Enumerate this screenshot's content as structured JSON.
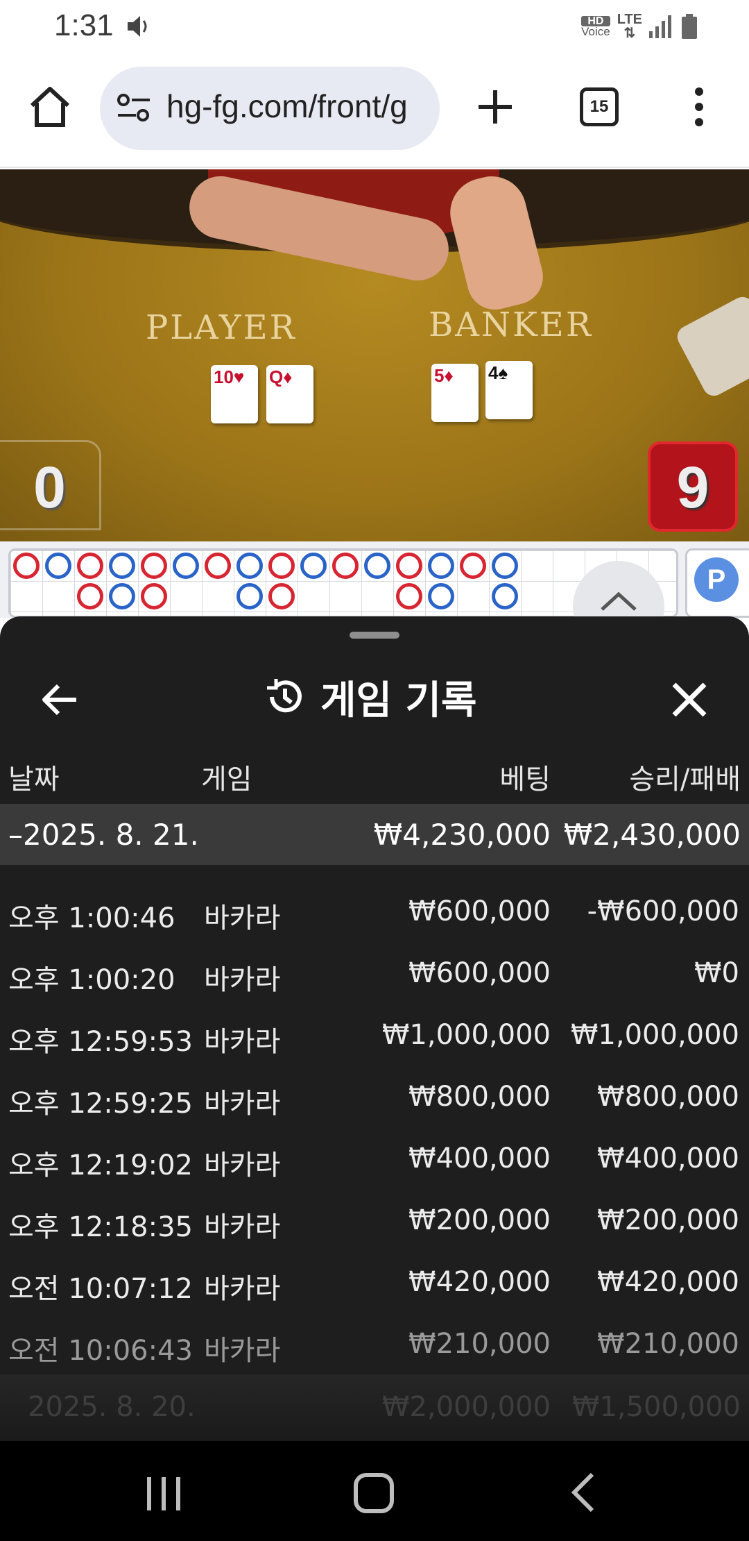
{
  "status_bar": {
    "time": "1:31",
    "hd_label": "HD",
    "voice_label": "Voice",
    "network": "LTE"
  },
  "browser": {
    "url": "hg-fg.com/front/g",
    "tab_count": "15"
  },
  "game_table": {
    "player_label": "PLAYER",
    "banker_label": "BANKER",
    "player_cards": [
      "10",
      "Q"
    ],
    "banker_cards": [
      "5",
      "4"
    ],
    "player_score": "0",
    "banker_score": "9",
    "side_badge": "P"
  },
  "history_sheet": {
    "title": "게임 기록",
    "columns": {
      "date": "날짜",
      "game": "게임",
      "bet": "베팅",
      "win_loss": "승리/패배"
    },
    "group": {
      "date": "–2025. 8. 21.",
      "bet_total": "₩4,230,000",
      "win_total": "₩2,430,000"
    },
    "rows": [
      {
        "time": "오후 1:00:46",
        "game": "바카라",
        "bet": "₩600,000",
        "result": "-₩600,000"
      },
      {
        "time": "오후 1:00:20",
        "game": "바카라",
        "bet": "₩600,000",
        "result": "₩0"
      },
      {
        "time": "오후 12:59:53",
        "game": "바카라",
        "bet": "₩1,000,000",
        "result": "₩1,000,000"
      },
      {
        "time": "오후 12:59:25",
        "game": "바카라",
        "bet": "₩800,000",
        "result": "₩800,000"
      },
      {
        "time": "오후 12:19:02",
        "game": "바카라",
        "bet": "₩400,000",
        "result": "₩400,000"
      },
      {
        "time": "오후 12:18:35",
        "game": "바카라",
        "bet": "₩200,000",
        "result": "₩200,000"
      },
      {
        "time": "오전 10:07:12",
        "game": "바카라",
        "bet": "₩420,000",
        "result": "₩420,000"
      },
      {
        "time": "오전 10:06:43",
        "game": "바카라",
        "bet": "₩210,000",
        "result": "₩210,000"
      }
    ],
    "next_group": {
      "date": "2025. 8. 20.",
      "bet_total": "₩2,000,000",
      "win_total": "₩1,500,000"
    }
  },
  "colors": {
    "sheet_bg": "#1e1e1e",
    "group_bg": "#3a3a3a",
    "banker_red": "#b3131a",
    "bead_red": "#d72532",
    "bead_blue": "#2a64c9"
  },
  "icons": {
    "home": "home-icon",
    "site_settings": "tune-icon",
    "new_tab": "plus-icon",
    "overflow": "more-vert-icon",
    "back": "arrow-left-icon",
    "history": "history-icon",
    "close": "close-icon",
    "scroll_up": "chevron-up-icon"
  }
}
